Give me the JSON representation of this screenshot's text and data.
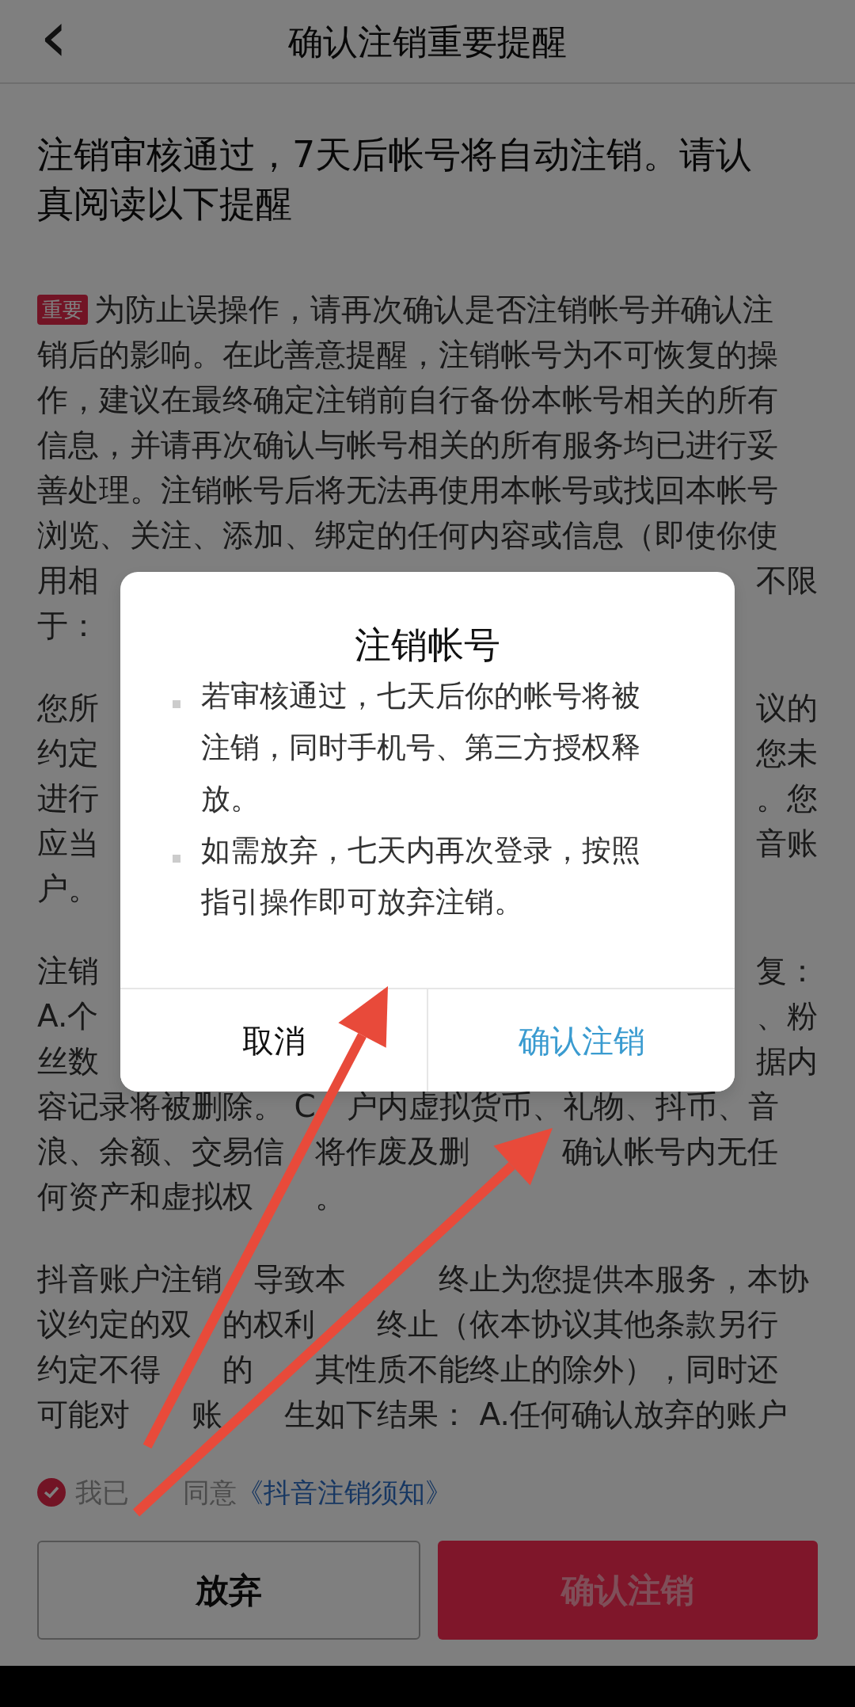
{
  "header": {
    "back": "‹",
    "title": "确认注销重要提醒"
  },
  "heading_lines": [
    "注销审核通过，7天后帐号将自动注销。请认",
    "真阅读以下提醒"
  ],
  "paragraphs": [
    {
      "badge": "重要",
      "lines": [
        {
          "text": "为防止误操作，请再次确认是否注销帐号并确认注"
        },
        {
          "text": "销后的影响。在此善意提醒，注销帐号为不可恢复的操"
        },
        {
          "text": "作，建议在最终确定注销前自行备份本帐号相关的所有"
        },
        {
          "text": "信息，并请再次确认与帐号相关的所有服务均已进行妥"
        },
        {
          "text": "善处理。注销帐号后将无法再使用本帐号或找回本帐号"
        },
        {
          "text": "浏览、关注、添加、绑定的任何内容或信息（即使你使"
        },
        {
          "left": "用相",
          "right": "不限"
        },
        {
          "text": "于："
        }
      ]
    },
    {
      "lines": [
        {
          "left": "您所",
          "right": "议的"
        },
        {
          "left": "约定",
          "right": "您未"
        },
        {
          "left": "进行",
          "right": "。您"
        },
        {
          "left": "应当",
          "right": "音账"
        },
        {
          "text": "户。"
        }
      ]
    },
    {
      "lines": [
        {
          "left": "注销",
          "right": "复："
        },
        {
          "left": "A.个",
          "right": "、粉"
        },
        {
          "left": "丝数",
          "right": "据内"
        },
        {
          "parts": [
            "容记录将被删除。 C",
            "户内虚拟货币、礼物、抖币、音"
          ]
        },
        {
          "parts": [
            "浪、余额、交易信",
            "将作废及删",
            "确认帐号内无任"
          ]
        },
        {
          "parts": [
            "何资产和虚拟权",
            "。"
          ]
        }
      ]
    },
    {
      "lines": [
        {
          "parts": [
            "抖音账户注销",
            "导致本",
            "终止为您提供本服务，本协"
          ]
        },
        {
          "parts": [
            "议约定的双",
            "的权利",
            "终止（依本协议其他条款另行"
          ]
        },
        {
          "parts": [
            "约定不得",
            "的",
            "其性质不能终止的除外），同时还"
          ]
        },
        {
          "parts": [
            "可能对",
            "账",
            "生如下结果： A.任何确认放弃的账户"
          ]
        }
      ]
    }
  ],
  "agreement": {
    "checked": true,
    "text_parts": [
      "我已",
      "同意"
    ],
    "link": "《抖音注销须知》"
  },
  "buttons": [
    {
      "label": "放弃",
      "kind": "outline"
    },
    {
      "label": "确认注销",
      "kind": "primary"
    }
  ],
  "dialog": {
    "title": "注销帐号",
    "bullets": [
      "若审核通过，七天后你的帐号将被注销，同时手机号、第三方授权释放。",
      "如需放弃，七天内再次登录，按照指引操作即可放弃注销。"
    ],
    "buttons": [
      {
        "label": "取消",
        "kind": "cancel"
      },
      {
        "label": "确认注销",
        "kind": "confirm"
      }
    ]
  }
}
